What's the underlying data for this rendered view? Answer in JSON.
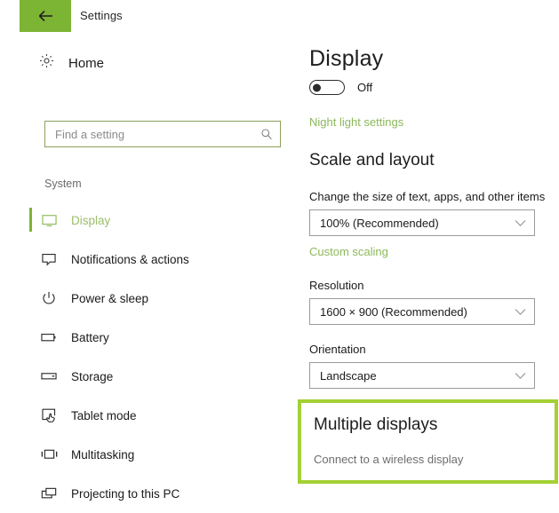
{
  "header": {
    "back_icon": "arrow-left-icon",
    "title": "Settings",
    "accent_color": "#7cb434"
  },
  "sidebar": {
    "home": {
      "label": "Home",
      "icon": "gear-icon"
    },
    "search": {
      "value": "",
      "placeholder": "Find a setting",
      "icon": "search-icon"
    },
    "group_label": "System",
    "items": [
      {
        "label": "Display",
        "icon": "monitor-icon",
        "selected": true
      },
      {
        "label": "Notifications & actions",
        "icon": "notification-icon",
        "selected": false
      },
      {
        "label": "Power & sleep",
        "icon": "power-icon",
        "selected": false
      },
      {
        "label": "Battery",
        "icon": "battery-icon",
        "selected": false
      },
      {
        "label": "Storage",
        "icon": "storage-icon",
        "selected": false
      },
      {
        "label": "Tablet mode",
        "icon": "tablet-mode-icon",
        "selected": false
      },
      {
        "label": "Multitasking",
        "icon": "multitasking-icon",
        "selected": false
      },
      {
        "label": "Projecting to this PC",
        "icon": "projecting-icon",
        "selected": false
      }
    ]
  },
  "content": {
    "page_title": "Display",
    "night_light_toggle": {
      "state": "Off",
      "on": false
    },
    "night_light_link": "Night light settings",
    "scale_section": {
      "title": "Scale and layout",
      "size_label": "Change the size of text, apps, and other items",
      "size_value": "100% (Recommended)",
      "custom_scaling_link": "Custom scaling",
      "resolution_label": "Resolution",
      "resolution_value": "1600 × 900 (Recommended)",
      "orientation_label": "Orientation",
      "orientation_value": "Landscape"
    },
    "multiple_displays": {
      "title": "Multiple displays",
      "wireless_link": "Connect to a wireless display",
      "highlight_color": "#a3d133"
    }
  }
}
